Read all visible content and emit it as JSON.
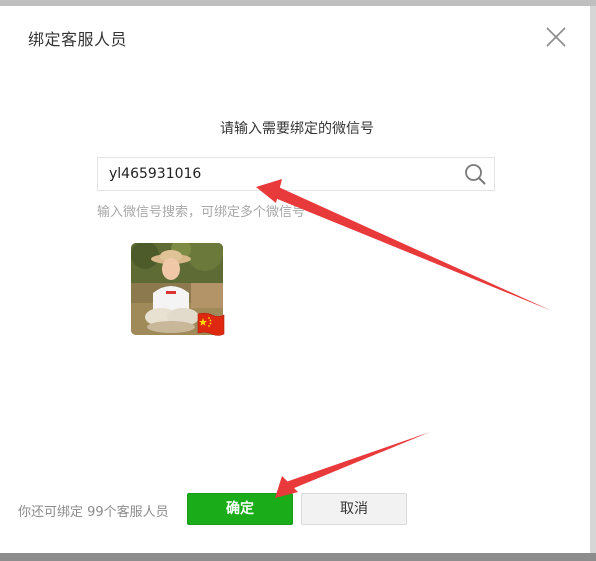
{
  "dialog": {
    "title": "绑定客服人员",
    "close_icon": "close-icon"
  },
  "bind": {
    "prompt": "请输入需要绑定的微信号",
    "search": {
      "value": "yl465931016",
      "icon": "search-icon"
    },
    "hint": "输入微信号搜索，可绑定多个微信号"
  },
  "result": {
    "avatar": "user-avatar",
    "flag": "china-flag-icon"
  },
  "footer": {
    "quota": "你还可绑定 99个客服人员",
    "confirm_label": "确定",
    "cancel_label": "取消"
  },
  "colors": {
    "primary": "#1aad19",
    "annotation_arrow": "#e8393b"
  }
}
